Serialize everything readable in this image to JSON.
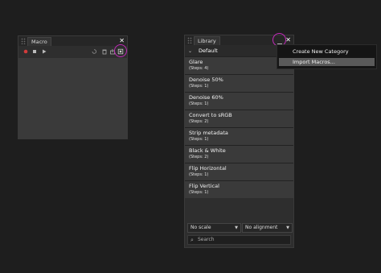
{
  "macro_panel": {
    "tab_label": "Macro",
    "close_glyph": "✕",
    "toolbar": {
      "record_icon": "record-icon",
      "stop_icon": "stop-icon",
      "play_icon": "play-icon",
      "undo_icon": "undo-icon",
      "delete_icon": "trash-icon",
      "export_icon": "export-icon",
      "add_to_library_icon": "add-to-library-icon"
    }
  },
  "library_panel": {
    "tab_label": "Library",
    "close_glyph": "✕",
    "category": "Default",
    "macros": [
      {
        "name": "Glare",
        "steps": "(Steps: 4)"
      },
      {
        "name": "Denoise 50%",
        "steps": "(Steps: 1)"
      },
      {
        "name": "Denoise 60%",
        "steps": "(Steps: 1)"
      },
      {
        "name": "Convert to sRGB",
        "steps": "(Steps: 2)"
      },
      {
        "name": "Strip metadata",
        "steps": "(Steps: 1)"
      },
      {
        "name": "Black & White",
        "steps": "(Steps: 2)"
      },
      {
        "name": "Flip Horizontal",
        "steps": "(Steps: 1)"
      },
      {
        "name": "Flip Vertical",
        "steps": "(Steps: 1)"
      }
    ],
    "scale_select": "No scale",
    "alignment_select": "No alignment",
    "search_placeholder": "Search"
  },
  "menu": {
    "items": [
      "Create New Category",
      "Import Macros..."
    ],
    "highlighted": "Import Macros..."
  },
  "colors": {
    "highlight_ring": "#c02ab7",
    "record_red": "#d23b3b"
  }
}
